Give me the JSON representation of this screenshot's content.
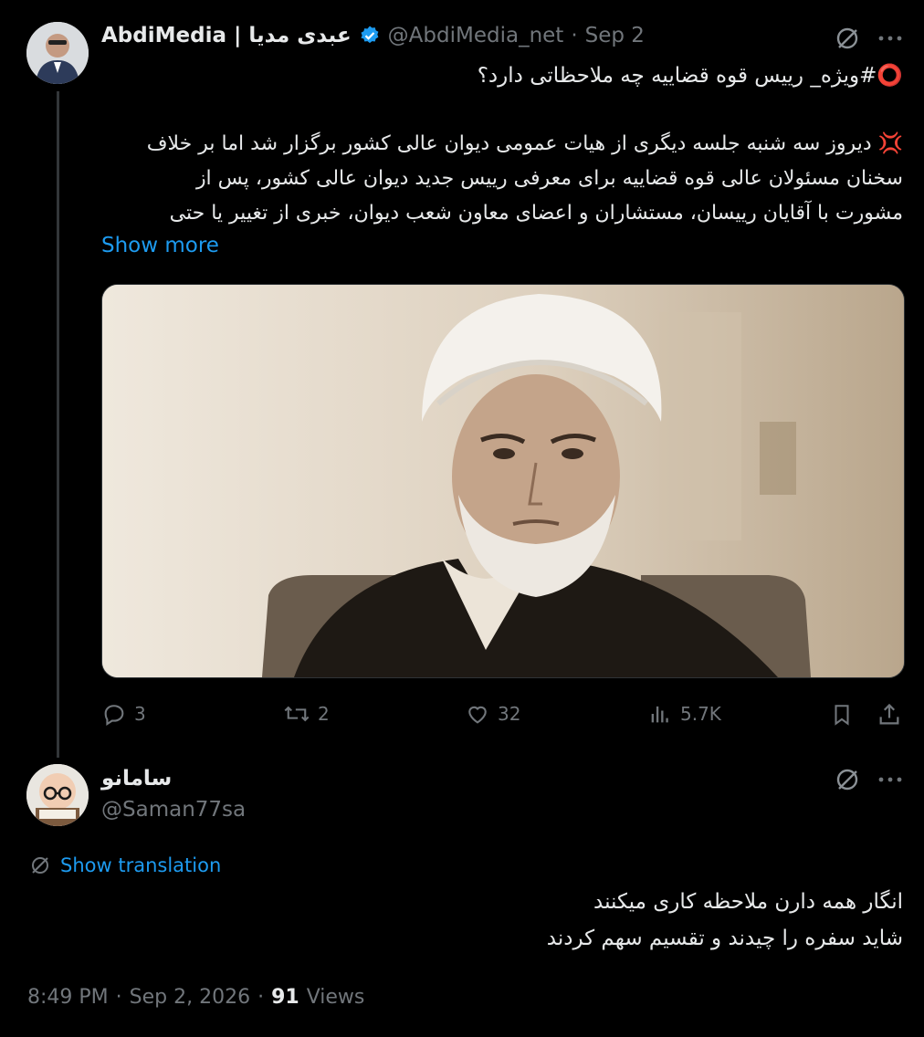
{
  "tweet": {
    "display_name": "AbdiMedia | عبدی مدیا",
    "handle": "@AbdiMedia_net",
    "dot": "·",
    "date": "Sep 2",
    "verified_icon": "verified-badge-icon",
    "headline": "⭕️#ویژه_  رییس قوه قضاییه چه ملاحظاتی دارد؟",
    "body_line1": "💢 دیروز سه شنبه جلسه دیگری از هیات عمومی دیوان عالی کشور برگزار شد اما بر خلاف",
    "body_line2": "سخنان مسئولان عالی قوه قضاییه برای معرفی رییس جدید دیوان عالی کشور، پس از",
    "body_line3": "مشورت با آقایان رییسان، مستشاران و اعضای معاون شعب دیوان، خبری از تغییر یا حتی",
    "show_more": "Show more",
    "actions": {
      "replies": "3",
      "reposts": "2",
      "likes": "32",
      "views": "5.7K"
    }
  },
  "reply": {
    "display_name": "سامانو",
    "handle": "@Saman77sa",
    "show_translation": "Show translation",
    "text_line1": "انگار همه دارن ملاحظه کاری میکنند",
    "text_line2": "شاید سفره را چیدند و تقسیم سهم کردند",
    "time": "8:49 PM",
    "sep1": "·",
    "date": "Sep 2, 2026",
    "sep2": "·",
    "views_count": "91",
    "views_label": "Views"
  },
  "colors": {
    "background": "#000000",
    "text": "#e7e9ea",
    "muted": "#71767b",
    "accent": "#1d9bf0",
    "verified": "#1d9bf0"
  }
}
